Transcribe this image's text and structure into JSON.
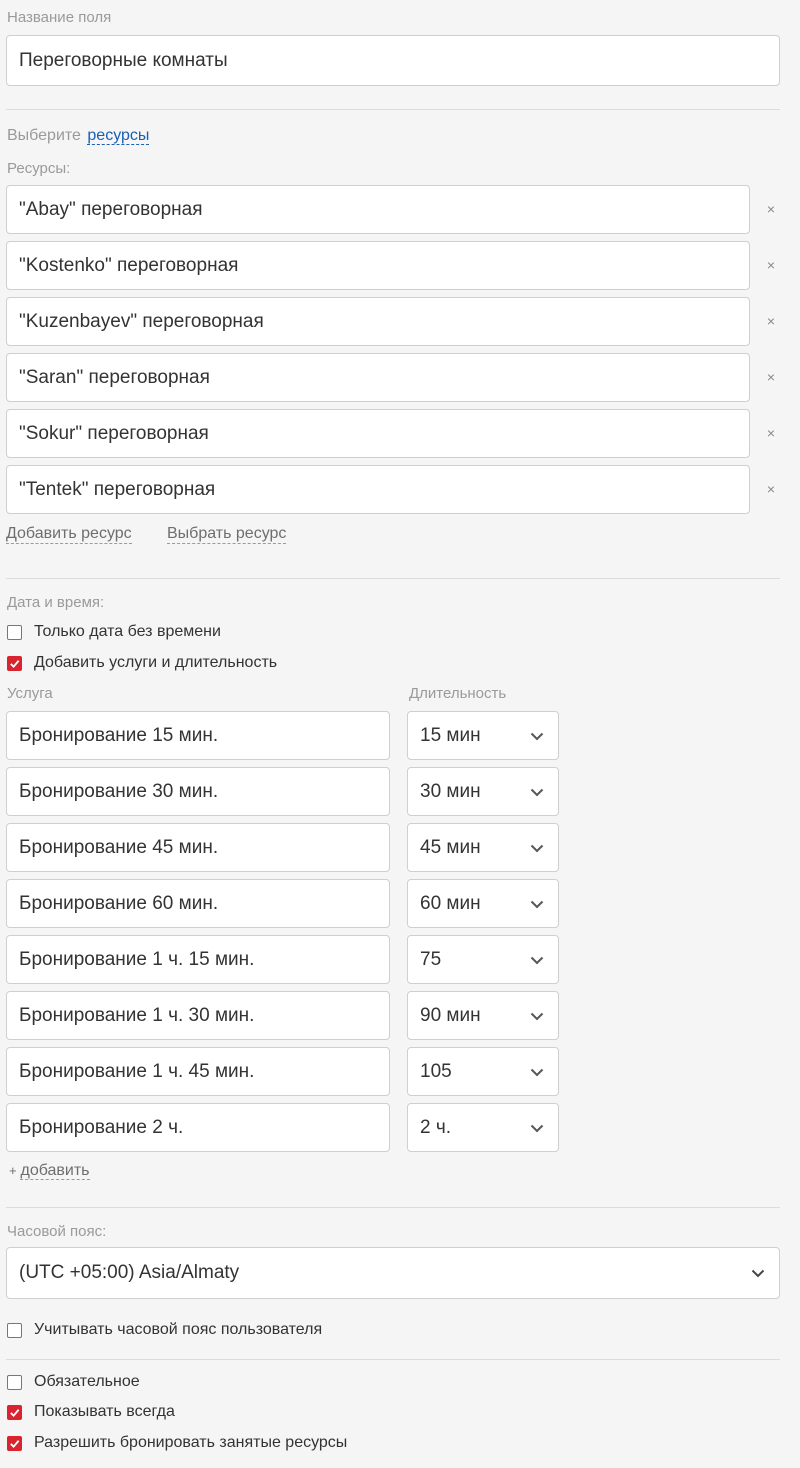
{
  "field_name": {
    "label": "Название поля",
    "value": "Переговорные комнаты"
  },
  "resources": {
    "choose_prefix": "Выберите",
    "choose_link": "ресурсы",
    "label": "Ресурсы:",
    "items": [
      "\"Abay\" переговорная",
      "\"Kostenko\" переговорная",
      "\"Kuzenbayev\" переговорная",
      "\"Saran\" переговорная",
      "\"Sokur\" переговорная",
      "\"Tentek\" переговорная"
    ],
    "remove_icon": "×",
    "add_link": "Добавить ресурс",
    "select_link": "Выбрать ресурс"
  },
  "datetime": {
    "label": "Дата и время:",
    "only_date": {
      "label": "Только дата без времени",
      "checked": false
    },
    "add_services": {
      "label": "Добавить услуги и длительность",
      "checked": true
    },
    "service_header": "Услуга",
    "duration_header": "Длительность",
    "services": [
      {
        "name": "Бронирование 15 мин.",
        "duration": "15 мин"
      },
      {
        "name": "Бронирование 30 мин.",
        "duration": "30 мин"
      },
      {
        "name": "Бронирование 45 мин.",
        "duration": "45 мин"
      },
      {
        "name": "Бронирование 60 мин.",
        "duration": "60 мин"
      },
      {
        "name": "Бронирование 1 ч. 15 мин.",
        "duration": "75"
      },
      {
        "name": "Бронирование 1 ч. 30 мин.",
        "duration": "90 мин"
      },
      {
        "name": "Бронирование 1 ч. 45 мин.",
        "duration": "105"
      },
      {
        "name": "Бронирование 2 ч.",
        "duration": "2 ч."
      }
    ],
    "add_plus": "+",
    "add_link": "добавить"
  },
  "timezone": {
    "label": "Часовой пояс:",
    "value": "(UTC +05:00) Asia/Almaty",
    "user_tz": {
      "label": "Учитывать часовой пояс пользователя",
      "checked": false
    }
  },
  "options": {
    "required": {
      "label": "Обязательное",
      "checked": false
    },
    "always_show": {
      "label": "Показывать всегда",
      "checked": true
    },
    "allow_busy": {
      "label": "Разрешить бронировать занятые ресурсы",
      "checked": true
    }
  },
  "colors": {
    "accent": "#d9232f",
    "link": "#1a5fb4"
  }
}
